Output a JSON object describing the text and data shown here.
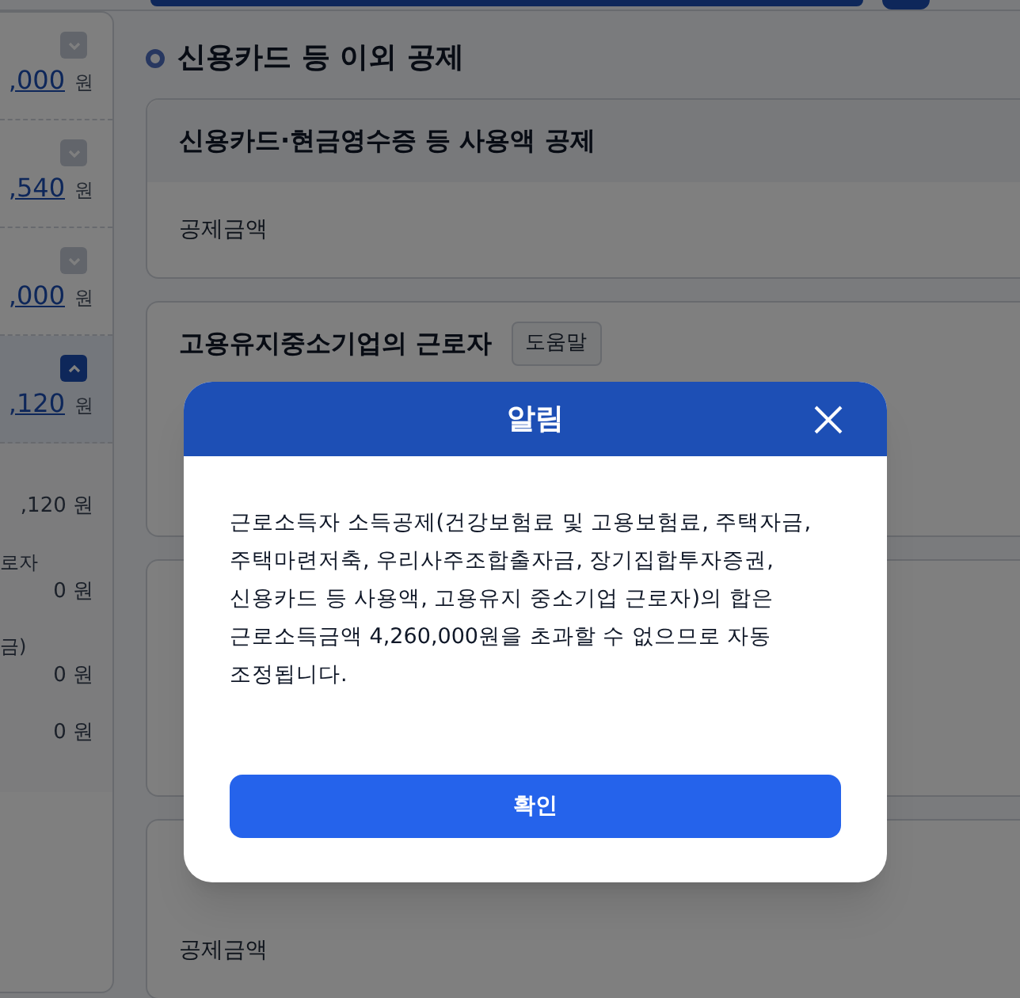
{
  "left_panel": {
    "rows": [
      {
        "amount": ",000",
        "unit": "원",
        "expanded": false
      },
      {
        "amount": ",540",
        "unit": "원",
        "expanded": false
      },
      {
        "amount": ",000",
        "unit": "원",
        "expanded": false
      },
      {
        "amount": ",120",
        "unit": "원",
        "expanded": true
      }
    ],
    "details": [
      {
        "amount": ",120 원"
      },
      {
        "label": "로자",
        "amount": "0 원"
      },
      {
        "label": "금)",
        "amount": "0 원"
      },
      {
        "amount": "0 원"
      }
    ]
  },
  "section": {
    "title": "신용카드 등 이외 공제",
    "cards": [
      {
        "title": "신용카드·현금영수증 등 사용액 공제",
        "body": "공제금액"
      },
      {
        "title": "고용유지중소기업의 근로자",
        "help": "도움말"
      },
      {
        "body": "공제금액"
      }
    ]
  },
  "dialog": {
    "title": "알림",
    "message": "근로소득자 소득공제(건강보험료 및 고용보험료, 주택자금, 주택마련저축, 우리사주조합출자금, 장기집합투자증권, 신용카드 등 사용액, 고용유지 중소기업 근로자)의 합은 근로소득금액 4,260,000원을 초과할 수 없으므로 자동 조정됩니다.",
    "confirm": "확인"
  }
}
